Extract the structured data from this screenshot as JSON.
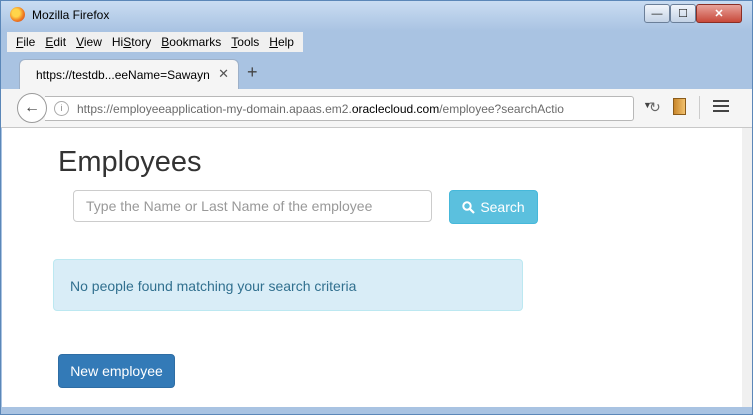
{
  "window": {
    "title": "Mozilla Firefox",
    "min_glyph": "—",
    "max_glyph": "☐",
    "close_glyph": "✕"
  },
  "menubar": {
    "items": [
      {
        "label": "File",
        "mnemonic": "F",
        "rest": "ile"
      },
      {
        "label": "Edit",
        "mnemonic": "E",
        "rest": "dit"
      },
      {
        "label": "View",
        "mnemonic": "V",
        "rest": "iew"
      },
      {
        "label": "History",
        "mnemonic": "S",
        "rest": "tory",
        "pre": "Hi"
      },
      {
        "label": "Bookmarks",
        "mnemonic": "B",
        "rest": "ookmarks"
      },
      {
        "label": "Tools",
        "mnemonic": "T",
        "rest": "ools"
      },
      {
        "label": "Help",
        "mnemonic": "H",
        "rest": "elp"
      }
    ]
  },
  "tab": {
    "title": "https://testdb...eeName=Sawayn",
    "close_glyph": "✕",
    "new_tab_glyph": "+"
  },
  "navbar": {
    "back_glyph": "←",
    "url_prefix": "https://employeeapplication-my-domain.apaas.em2.",
    "url_domain": "oraclecloud.com",
    "url_suffix": "/employee?searchActio",
    "reload_glyph": "↻",
    "dropdown_glyph": "▼"
  },
  "page": {
    "title": "Employees",
    "search_placeholder": "Type the Name or Last Name of the employee",
    "search_value": "",
    "search_button": "Search",
    "alert": "No people found matching your search criteria",
    "new_button": "New employee"
  },
  "colors": {
    "info_button": "#5bc0de",
    "primary_button": "#337ab7",
    "alert_bg": "#d9edf7",
    "alert_text": "#31708f"
  }
}
